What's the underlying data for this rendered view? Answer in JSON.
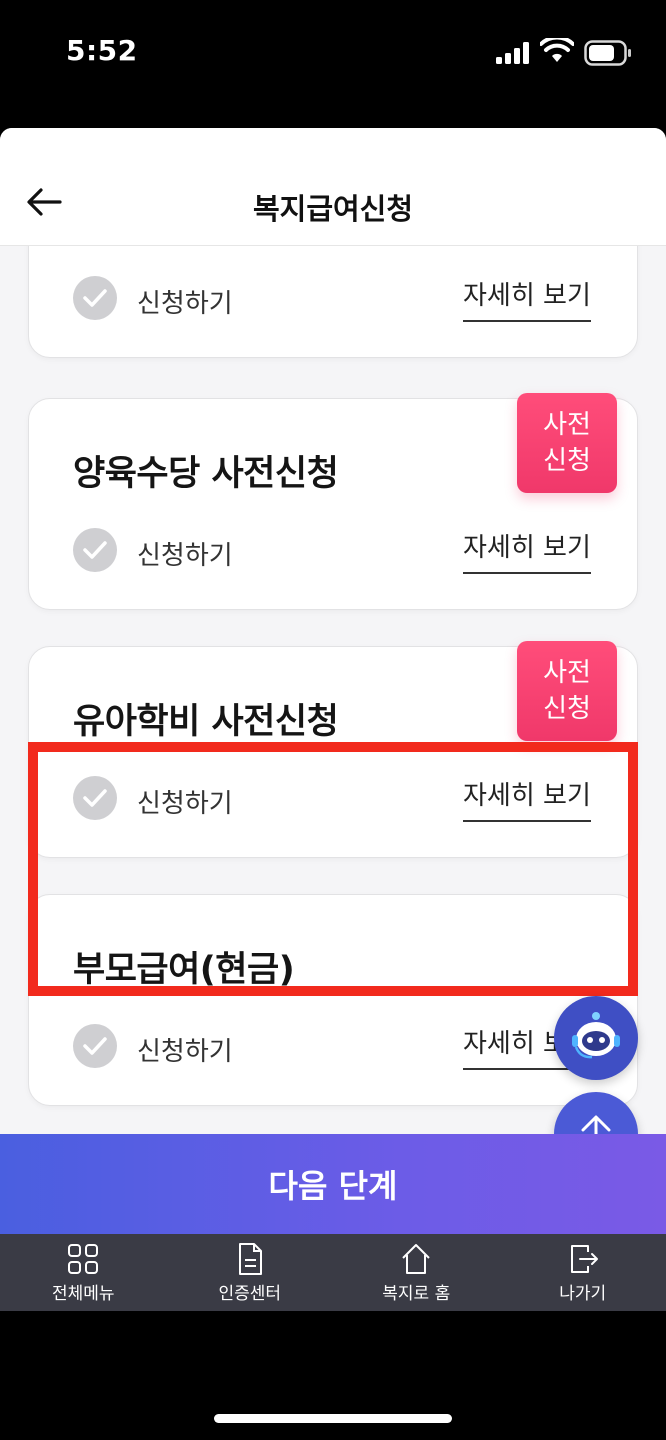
{
  "status_bar": {
    "time": "5:52"
  },
  "header": {
    "title": "복지급여신청"
  },
  "cards": [
    {
      "title": "",
      "apply_label": "신청하기",
      "detail_label": "자세히 보기"
    },
    {
      "title": "양육수당 사전신청",
      "apply_label": "신청하기",
      "detail_label": "자세히 보기",
      "badge": [
        "사전",
        "신청"
      ]
    },
    {
      "title": "유아학비 사전신청",
      "apply_label": "신청하기",
      "detail_label": "자세히 보기",
      "badge": [
        "사전",
        "신청"
      ]
    },
    {
      "title": "부모급여(현금)",
      "apply_label": "신청하기",
      "detail_label": "자세히 보기"
    }
  ],
  "next_button": {
    "label": "다음 단계"
  },
  "bottom_nav": [
    {
      "label": "전체메뉴",
      "icon": "grid-icon"
    },
    {
      "label": "인증센터",
      "icon": "document-icon"
    },
    {
      "label": "복지로 홈",
      "icon": "home-icon"
    },
    {
      "label": "나가기",
      "icon": "exit-icon"
    }
  ],
  "colors": {
    "badge": "#f0386a",
    "highlight": "#f22a1d",
    "next_button_start": "#4a5fe0",
    "next_button_end": "#7a5ae6",
    "bottom_nav_bg": "#3a3b45"
  }
}
